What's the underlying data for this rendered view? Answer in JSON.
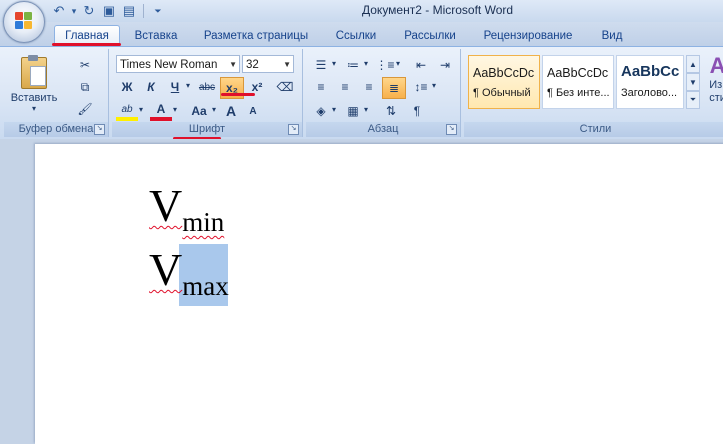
{
  "window": {
    "title": "Документ2 - Microsoft Word"
  },
  "quick_access": [
    {
      "icon": "undo-icon",
      "glyph": "↶"
    },
    {
      "icon": "undo-dropdown-icon",
      "glyph": "▾"
    },
    {
      "icon": "redo-icon",
      "glyph": "↻"
    },
    {
      "icon": "image-icon",
      "glyph": "▣"
    },
    {
      "icon": "save-icon",
      "glyph": "▤"
    },
    {
      "icon": "customize-qat-icon",
      "glyph": "⏷"
    }
  ],
  "tabs": [
    "Главная",
    "Вставка",
    "Разметка страницы",
    "Ссылки",
    "Рассылки",
    "Рецензирование",
    "Вид"
  ],
  "active_tab": "Главная",
  "groups": {
    "clipboard": {
      "label": "Буфер обмена",
      "paste_label": "Вставить"
    },
    "font": {
      "label": "Шрифт",
      "font_name": "Times New Roman",
      "font_size": "32"
    },
    "paragraph": {
      "label": "Абзац"
    },
    "styles": {
      "label": "Стили",
      "items": [
        {
          "sample": "AaBbCcDc",
          "name": "¶ Обычный"
        },
        {
          "sample": "AaBbCcDc",
          "name": "¶ Без инте..."
        },
        {
          "sample": "AaBbCc",
          "name": "Заголово..."
        }
      ],
      "change_label": "Изм\nсти"
    }
  },
  "font_buttons": {
    "bold": "Ж",
    "italic": "К",
    "underline": "Ч",
    "strike": "abc",
    "subscript": "x₂",
    "superscript": "x²",
    "highlight": "ab",
    "font_color": "A",
    "case": "Aa",
    "grow": "A",
    "shrink": "A"
  },
  "document": {
    "line1": {
      "main": "V",
      "sub": "min"
    },
    "line2": {
      "main": "V",
      "sub": "max"
    }
  },
  "colors": {
    "accent_red": "#e0102b",
    "selection": "#a9c8ec"
  }
}
